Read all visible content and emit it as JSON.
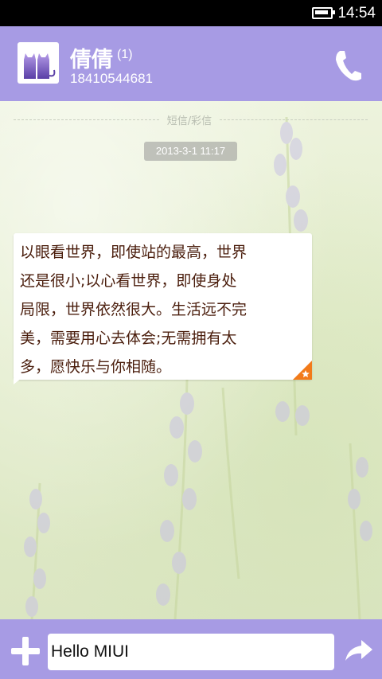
{
  "status_bar": {
    "time": "14:54",
    "battery_icon": "battery-icon"
  },
  "header": {
    "contact_name": "倩倩",
    "unread_count": "(1)",
    "phone_number": "18410544681",
    "avatar_icon": "cats-avatar-icon",
    "call_icon": "phone-icon"
  },
  "conversation": {
    "channel_label": "短信/彩信",
    "timestamp": "2013-3-1 11:17",
    "message": {
      "text": "以眼看世界，即使站的最高，世界\n还是很小;以心看世界，即使身处\n局限，世界依然很大。生活远不完\n美，需要用心去体会;无需拥有太\n多，愿快乐与你相随。",
      "corner_icon": "star-icon"
    }
  },
  "input_bar": {
    "add_icon": "plus-icon",
    "input_value": "Hello MIUI",
    "send_icon": "send-arrow-icon"
  },
  "colors": {
    "accent": "#a79be4",
    "status_bar": "#000000",
    "message_text": "#4a1d0c",
    "star_badge": "#f27a1a"
  }
}
